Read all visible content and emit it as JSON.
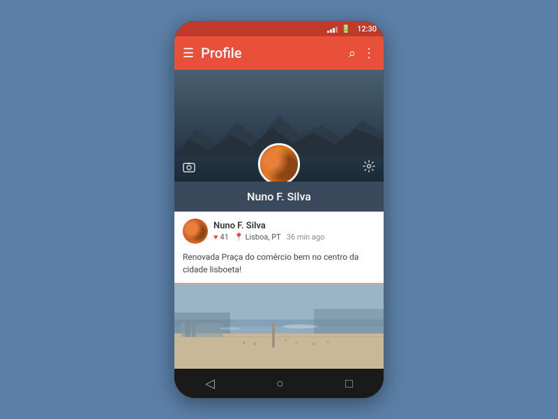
{
  "statusBar": {
    "time": "12:30",
    "signalBars": [
      3,
      5,
      7,
      9,
      11
    ]
  },
  "appBar": {
    "menuIcon": "☰",
    "title": "Profile",
    "searchIcon": "⌕",
    "moreIcon": "⋮"
  },
  "profileHeader": {
    "coverPhotoIcon": "🖼",
    "settingsIcon": "⚙",
    "name": "Nuno F. Silva"
  },
  "post": {
    "author": "Nuno F. Silva",
    "likesCount": "41",
    "location": "Lisboa, PT",
    "timeAgo": "36 min ago",
    "text": "Renovada Praça do comércio bem no centro da cidade lisboeta!"
  },
  "navBar": {
    "backIcon": "◁",
    "homeIcon": "○",
    "recentIcon": "□"
  }
}
